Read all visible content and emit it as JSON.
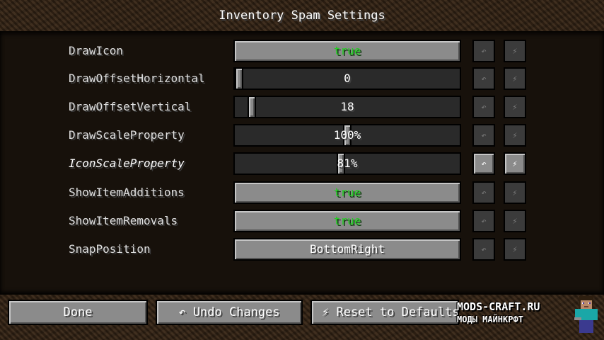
{
  "title": "Inventory Spam Settings",
  "rows": [
    {
      "label": "DrawIcon",
      "type": "toggle",
      "value": "true"
    },
    {
      "label": "DrawOffsetHorizontal",
      "type": "slider",
      "value": "0",
      "level": 0
    },
    {
      "label": "DrawOffsetVertical",
      "type": "slider",
      "value": "18",
      "level": 0.06
    },
    {
      "label": "DrawScaleProperty",
      "type": "slider",
      "value": "100%",
      "level": 0.5
    },
    {
      "label": "IconScaleProperty",
      "type": "slider",
      "value": "81%",
      "level": 0.47
    },
    {
      "label": "ShowItemAdditions",
      "type": "toggle",
      "value": "true"
    },
    {
      "label": "ShowItemRemovals",
      "type": "toggle",
      "value": "true"
    },
    {
      "label": "SnapPosition",
      "type": "cycle",
      "value": "BottomRight"
    }
  ],
  "row_buttons": {
    "undo_icon": "↶",
    "reset_icon": "⚡"
  },
  "footer": {
    "done": "Done",
    "undo": "↶ Undo Changes",
    "reset": "⚡ Reset to Defaults"
  },
  "watermark": {
    "line1": "MODS-CRAFT.RU",
    "line2": "МОДЫ МАЙНКРФТ"
  },
  "colors": {
    "true_text": "#24d024",
    "button": "#8b8b8b"
  }
}
